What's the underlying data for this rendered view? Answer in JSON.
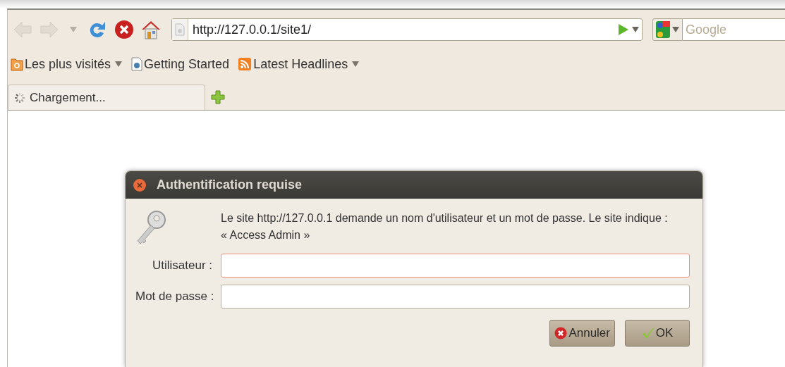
{
  "toolbar": {
    "nav": [
      {
        "kind": "back",
        "disabled": true
      },
      {
        "kind": "forward",
        "disabled": true
      },
      {
        "kind": "history",
        "disabled": true
      },
      {
        "kind": "reload",
        "disabled": false
      },
      {
        "kind": "stop",
        "disabled": false
      },
      {
        "kind": "home",
        "disabled": false
      }
    ],
    "url": "http://127.0.0.1/site1/",
    "search": {
      "placeholder": "Google"
    }
  },
  "bookmarks": [
    {
      "label": "Les plus visités",
      "kind": "folder",
      "dropdown": true
    },
    {
      "label": "Getting Started",
      "kind": "page",
      "dropdown": false
    },
    {
      "label": "Latest Headlines",
      "kind": "feed",
      "dropdown": true
    }
  ],
  "tabs": [
    {
      "label": "Chargement...",
      "selected": true
    }
  ],
  "dialog": {
    "title": "Authentification requise",
    "message": "Le site http://127.0.0.1 demande un nom d'utilisateur et un mot de passe. Le site indique :\n« Access Admin »",
    "fields": [
      {
        "label": "Utilisateur :",
        "focused": true
      },
      {
        "label": "Mot de passe :",
        "focused": false
      }
    ],
    "buttons": [
      {
        "label": "Annuler",
        "kind": "cancel"
      },
      {
        "label": "OK",
        "kind": "ok"
      }
    ]
  }
}
